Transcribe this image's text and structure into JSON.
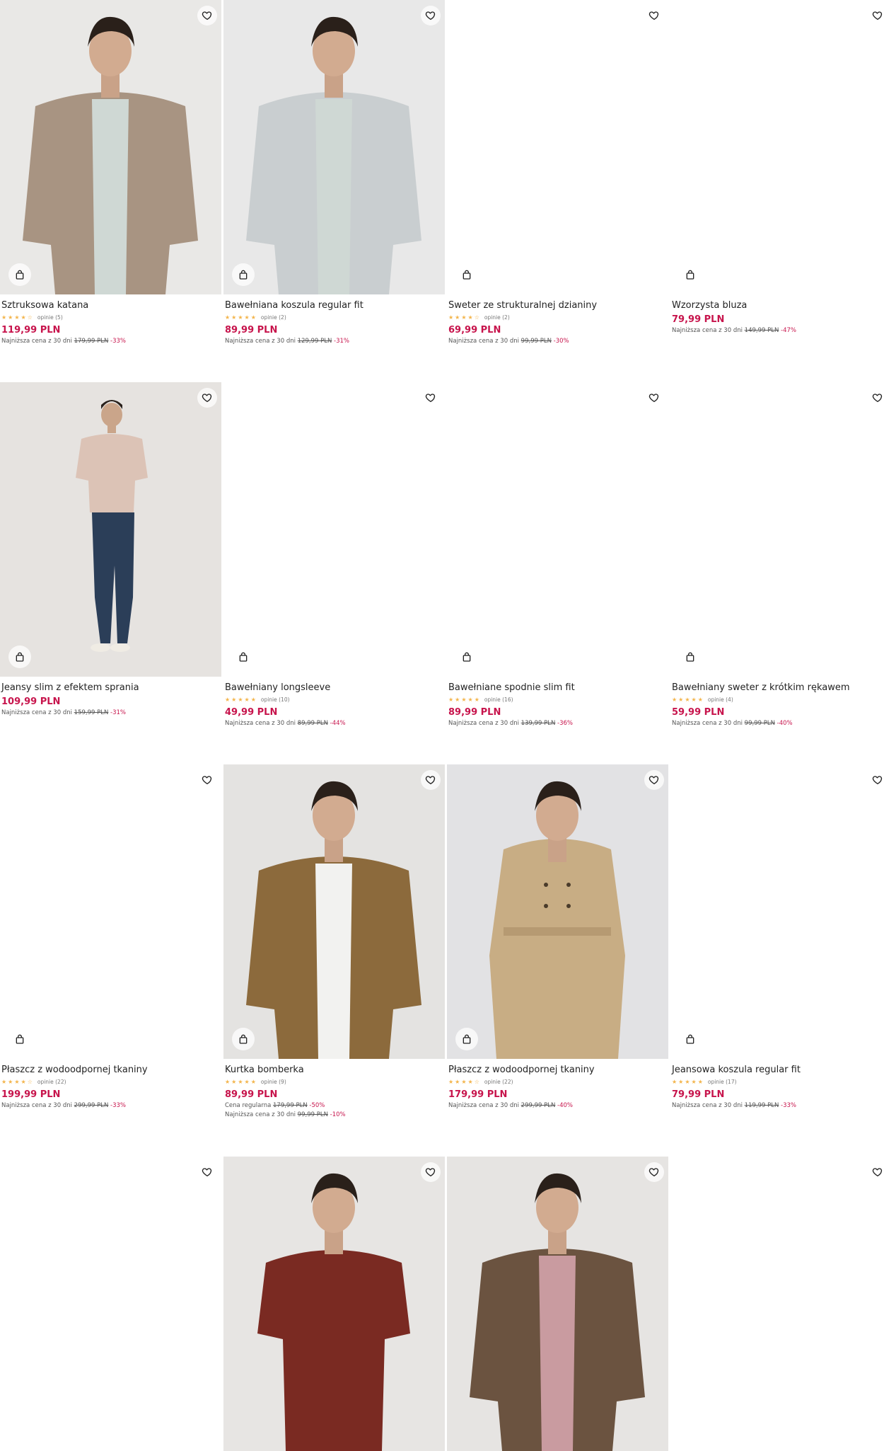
{
  "products": [
    {
      "name": "Sztruksowa katana",
      "stars": "★★★★☆",
      "reviews": "opinie (5)",
      "price": "119,99 PLN",
      "lowest_label": "Najniższa cena z 30 dni",
      "lowest_old": "179,99 PLN",
      "lowest_disc": "-33%",
      "image": "photo-man-corduroy-jacket",
      "colors": {
        "bg": "#e9e8e6",
        "garment": "#a89482"
      }
    },
    {
      "name": "Bawełniana koszula regular fit",
      "stars": "★★★★★",
      "reviews": "opinie (2)",
      "price": "89,99 PLN",
      "lowest_label": "Najniższa cena z 30 dni",
      "lowest_old": "129,99 PLN",
      "lowest_disc": "-31%",
      "image": "photo-man-grey-shirt",
      "colors": {
        "bg": "#e8e8e8",
        "garment": "#c9ced0"
      }
    },
    {
      "name": "Sweter ze strukturalnej dzianiny",
      "stars": "★★★★☆",
      "reviews": "opinie (2)",
      "price": "69,99 PLN",
      "lowest_label": "Najniższa cena z 30 dni",
      "lowest_old": "99,99 PLN",
      "lowest_disc": "-30%",
      "image": "",
      "colors": {
        "bg": "#ffffff",
        "garment": ""
      }
    },
    {
      "name": "Wzorzysta bluza",
      "stars": "",
      "reviews": "",
      "price": "79,99 PLN",
      "lowest_label": "Najniższa cena z 30 dni",
      "lowest_old": "149,99 PLN",
      "lowest_disc": "-47%",
      "image": "",
      "colors": {
        "bg": "#ffffff",
        "garment": ""
      }
    },
    {
      "name": "Jeansy slim z efektem sprania",
      "stars": "",
      "reviews": "",
      "price": "109,99 PLN",
      "lowest_label": "Najniższa cena z 30 dni",
      "lowest_old": "159,99 PLN",
      "lowest_disc": "-31%",
      "image": "photo-man-jeans-standing",
      "colors": {
        "bg": "#e6e3e0",
        "garment": "#2b3e58"
      }
    },
    {
      "name": "Bawełniany longsleeve",
      "stars": "★★★★★",
      "reviews": "opinie (10)",
      "price": "49,99 PLN",
      "lowest_label": "Najniższa cena z 30 dni",
      "lowest_old": "89,99 PLN",
      "lowest_disc": "-44%",
      "image": "",
      "colors": {
        "bg": "#ffffff",
        "garment": ""
      }
    },
    {
      "name": "Bawełniane spodnie slim fit",
      "stars": "★★★★★",
      "reviews": "opinie (16)",
      "price": "89,99 PLN",
      "lowest_label": "Najniższa cena z 30 dni",
      "lowest_old": "139,99 PLN",
      "lowest_disc": "-36%",
      "image": "",
      "colors": {
        "bg": "#ffffff",
        "garment": ""
      }
    },
    {
      "name": "Bawełniany sweter z krótkim rękawem",
      "stars": "★★★★★",
      "reviews": "opinie (4)",
      "price": "59,99 PLN",
      "lowest_label": "Najniższa cena z 30 dni",
      "lowest_old": "99,99 PLN",
      "lowest_disc": "-40%",
      "image": "",
      "colors": {
        "bg": "#ffffff",
        "garment": ""
      }
    },
    {
      "name": "Płaszcz z wodoodpornej tkaniny",
      "stars": "★★★★☆",
      "reviews": "opinie (22)",
      "price": "199,99 PLN",
      "lowest_label": "Najniższa cena z 30 dni",
      "lowest_old": "299,99 PLN",
      "lowest_disc": "-33%",
      "image": "",
      "colors": {
        "bg": "#ffffff",
        "garment": ""
      }
    },
    {
      "name": "Kurtka bomberka",
      "stars": "★★★★★",
      "reviews": "opinie (9)",
      "price": "89,99 PLN",
      "regular_label": "Cena regularna",
      "regular_old": "179,99 PLN",
      "regular_disc": "-50%",
      "lowest_label": "Najniższa cena z 30 dni",
      "lowest_old": "99,99 PLN",
      "lowest_disc": "-10%",
      "image": "photo-man-bomber-jacket",
      "colors": {
        "bg": "#e4e3e1",
        "garment": "#8c6a3c"
      }
    },
    {
      "name": "Płaszcz z wodoodpornej tkaniny",
      "stars": "★★★★☆",
      "reviews": "opinie (22)",
      "price": "179,99 PLN",
      "lowest_label": "Najniższa cena z 30 dni",
      "lowest_old": "299,99 PLN",
      "lowest_disc": "-40%",
      "image": "photo-man-trench-coat",
      "colors": {
        "bg": "#e2e2e4",
        "garment": "#c8ad84"
      }
    },
    {
      "name": "Jeansowa koszula regular fit",
      "stars": "★★★★★",
      "reviews": "opinie (17)",
      "price": "79,99 PLN",
      "lowest_label": "Najniższa cena z 30 dni",
      "lowest_old": "119,99 PLN",
      "lowest_disc": "-33%",
      "image": "",
      "colors": {
        "bg": "#ffffff",
        "garment": ""
      }
    },
    {
      "name": "",
      "stars": "",
      "reviews": "",
      "price": "",
      "lowest_label": "",
      "lowest_old": "",
      "lowest_disc": "",
      "image": "",
      "colors": {
        "bg": "#ffffff",
        "garment": ""
      }
    },
    {
      "name": "",
      "stars": "",
      "reviews": "",
      "price": "",
      "lowest_label": "",
      "lowest_old": "",
      "lowest_disc": "",
      "image": "photo-man-burgundy-sweater",
      "colors": {
        "bg": "#e7e5e3",
        "garment": "#7a2a22"
      }
    },
    {
      "name": "",
      "stars": "",
      "reviews": "",
      "price": "",
      "lowest_label": "",
      "lowest_old": "",
      "lowest_disc": "",
      "image": "photo-man-brown-suede-jacket",
      "colors": {
        "bg": "#e6e4e2",
        "garment": "#6b5340"
      }
    },
    {
      "name": "",
      "stars": "",
      "reviews": "",
      "price": "",
      "lowest_label": "",
      "lowest_old": "",
      "lowest_disc": "",
      "image": "",
      "colors": {
        "bg": "#ffffff",
        "garment": ""
      }
    }
  ],
  "icons": {
    "wishlist": "heart-icon",
    "add_to_cart": "shopping-bag-icon"
  },
  "accent_color": "#c7144c"
}
